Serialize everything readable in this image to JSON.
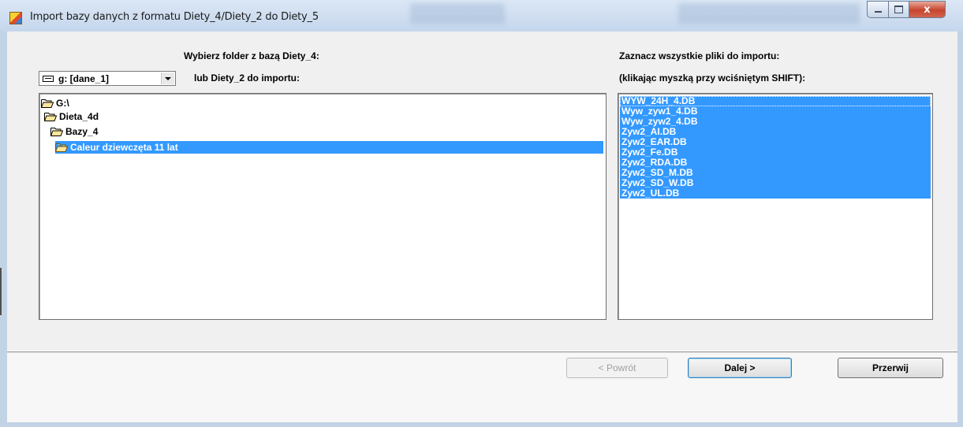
{
  "window": {
    "title": "Import bazy danych z formatu Diety_4/Diety_2 do Diety_5",
    "controls": {
      "close_glyph": "x"
    }
  },
  "left_panel": {
    "heading_line1": "Wybierz folder z bazą Diety_4:",
    "heading_line2": "lub Diety_2 do importu:",
    "drive_select": {
      "value": "g: [dane_1]",
      "icon": "drive-icon"
    },
    "folder_tree": [
      {
        "label": "G:\\",
        "icon": "open-folder-icon",
        "selected": false
      },
      {
        "label": "Dieta_4d",
        "icon": "open-folder-icon",
        "selected": false
      },
      {
        "label": "Bazy_4",
        "icon": "open-folder-icon",
        "selected": false
      },
      {
        "label": "Caleur dziewczęta 11 lat",
        "icon": "open-folder-icon",
        "selected": true
      }
    ]
  },
  "right_panel": {
    "heading_line1": "Zaznacz wszystkie pliki do importu:",
    "heading_line2": "(klikając myszką przy wciśniętym SHIFT):",
    "files": [
      "WYW_24H_4.DB",
      "Wyw_zyw1_4.DB",
      "Wyw_zyw2_4.DB",
      "Zyw2_AI.DB",
      "Zyw2_EAR.DB",
      "Zyw2_Fe.DB",
      "Zyw2_RDA.DB",
      "Zyw2_SD_M.DB",
      "Zyw2_SD_W.DB",
      "Zyw2_UL.DB"
    ]
  },
  "buttons": {
    "back": "< Powrót",
    "next": "Dalej >",
    "cancel": "Przerwij"
  },
  "colors": {
    "selection": "#3399ff",
    "dialog_bg": "#f0f0f0",
    "frame": "#c3d3e6"
  }
}
